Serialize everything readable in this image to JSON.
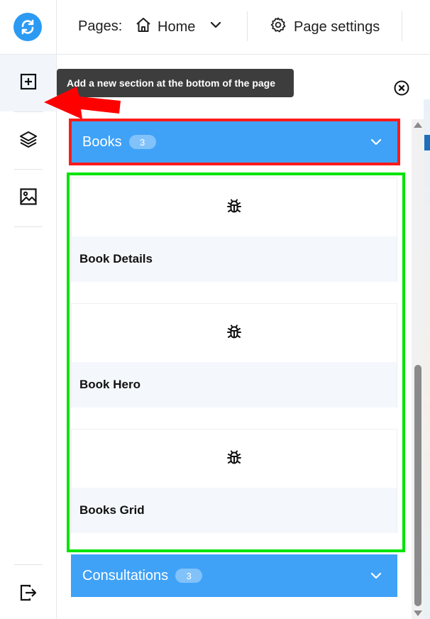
{
  "topbar": {
    "pages_label": "Pages:",
    "current_page": "Home",
    "page_settings_label": "Page settings"
  },
  "tooltip": {
    "text": "Add a new section at the bottom of the page"
  },
  "sections": [
    {
      "title": "Books",
      "count": "3",
      "items": [
        {
          "label": "Book Details",
          "icon": "bug-icon"
        },
        {
          "label": "Book Hero",
          "icon": "bug-icon"
        },
        {
          "label": "Books Grid",
          "icon": "bug-icon"
        }
      ]
    },
    {
      "title": "Consultations",
      "count": "3"
    }
  ],
  "colors": {
    "accent": "#3fa2f7",
    "logo": "#2b9af3",
    "highlight_red": "#ff1a1a",
    "highlight_green": "#00e400",
    "arrow_red": "#ff0000",
    "tooltip_bg": "#3d3d3d"
  },
  "rail_icons": [
    "add-section-icon",
    "layers-icon",
    "image-icon",
    "exit-icon"
  ]
}
